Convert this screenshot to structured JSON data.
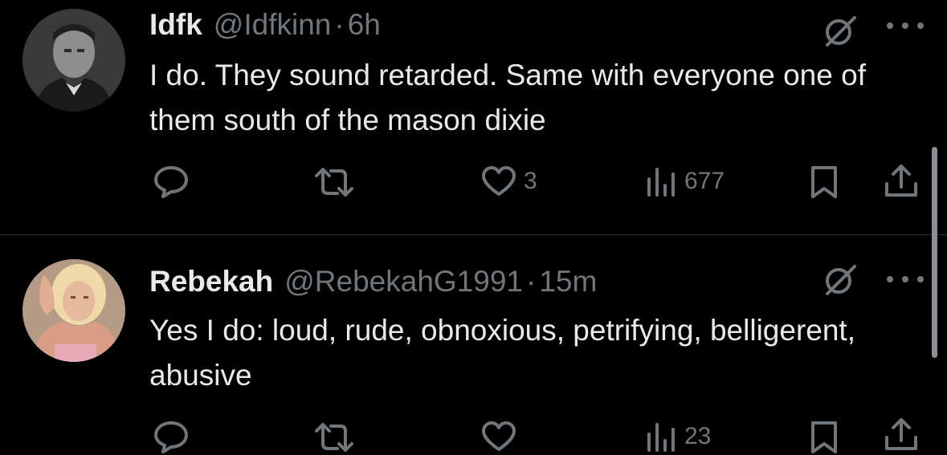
{
  "tweets": [
    {
      "name": "Idfk",
      "handle": "@Idfkinn",
      "separator": "·",
      "time": "6h",
      "text": "I do. They sound retarded. Same with everyone one of them south of the mason dixie",
      "likes": "3",
      "views": "677"
    },
    {
      "name": "Rebekah",
      "handle": "@RebekahG1991",
      "separator": "·",
      "time": "15m",
      "text": "Yes I do: loud, rude, obnoxious, petrifying, belligerent, abusive",
      "likes": "",
      "views": "23"
    }
  ],
  "icons": {
    "reply": "reply-icon",
    "retweet": "retweet-icon",
    "like": "heart-icon",
    "views": "views-icon",
    "bookmark": "bookmark-icon",
    "share": "share-icon",
    "grok": "grok-icon",
    "more": "more-icon"
  },
  "colors": {
    "background": "#000000",
    "text": "#e7e9ea",
    "secondary": "#71767b",
    "divider": "#2f3336"
  }
}
